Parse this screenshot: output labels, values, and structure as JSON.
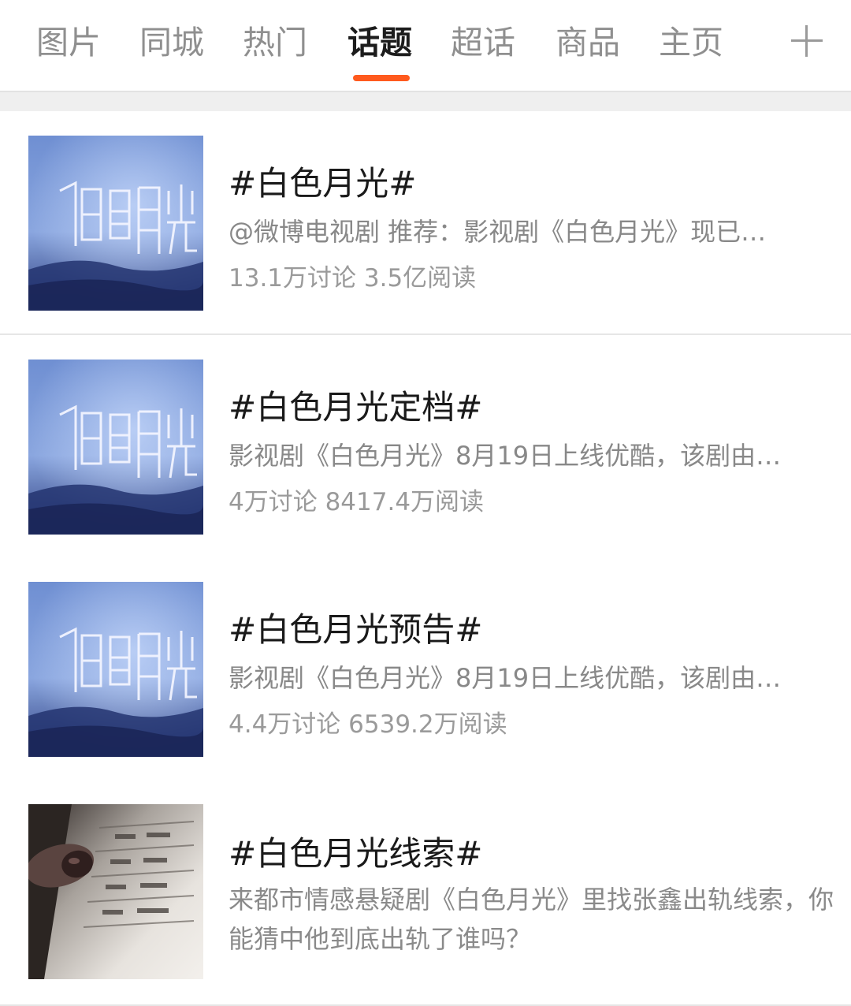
{
  "tabs": [
    {
      "label": "图片",
      "active": false
    },
    {
      "label": "同城",
      "active": false
    },
    {
      "label": "热门",
      "active": false
    },
    {
      "label": "话题",
      "active": true
    },
    {
      "label": "超话",
      "active": false
    },
    {
      "label": "商品",
      "active": false
    },
    {
      "label": "主页",
      "active": false
    }
  ],
  "add_tab_icon": "plus-icon",
  "colors": {
    "accent": "#ff5a1e",
    "tab_inactive": "#8f8f8f",
    "tab_active": "#1c1c1c",
    "meta_text": "#888888"
  },
  "topics": [
    {
      "title": "#白色月光#",
      "description": "@微博电视剧 推荐：影视剧《白色月光》现已…",
      "stats": "13.1万讨论 3.5亿阅读",
      "thumbnail": "poster-白色月光"
    },
    {
      "title": "#白色月光定档#",
      "description": "影视剧《白色月光》8月19日上线优酷，该剧由…",
      "stats": "4万讨论 8417.4万阅读",
      "thumbnail": "poster-白色月光"
    },
    {
      "title": "#白色月光预告#",
      "description": "影视剧《白色月光》8月19日上线优酷，该剧由…",
      "stats": "4.4万讨论 6539.2万阅读",
      "thumbnail": "poster-白色月光"
    },
    {
      "title": "#白色月光线索#",
      "description": "来都市情感悬疑剧《白色月光》里找张鑫出轨线索，你能猜中他到底出轨了谁吗？",
      "stats": "",
      "thumbnail": "photo-receipt"
    }
  ]
}
